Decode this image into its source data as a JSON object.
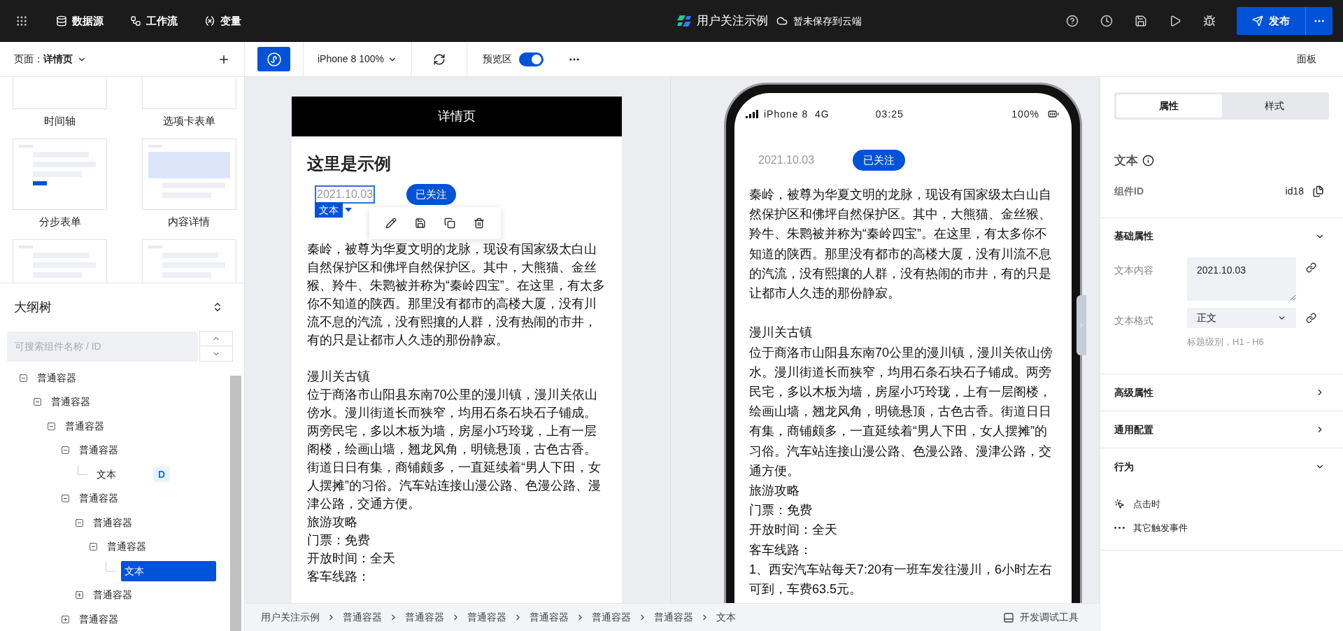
{
  "top_bar": {
    "menu": [
      {
        "label": "数据源"
      },
      {
        "label": "工作流"
      },
      {
        "label": "变量"
      }
    ],
    "app_title": "用户关注示例",
    "save_status": "暂未保存到云端",
    "publish_button": "发布"
  },
  "toolbar": {
    "page_label": "页面：**详情页**",
    "device": "iPhone 8 100%",
    "preview_label": "预览区",
    "preview_on": true,
    "panel_label": "面板"
  },
  "templates": [
    {
      "label": "时间轴"
    },
    {
      "label": "选项卡表单"
    },
    {
      "label": "分步表单"
    },
    {
      "label": "内容详情"
    }
  ],
  "outline": {
    "title": "大纲树",
    "search_placeholder": "可搜索组件名称 / ID",
    "tree": [
      {
        "label": "普通容器",
        "expanded": true,
        "selected": false,
        "children": [
          {
            "label": "普通容器",
            "expanded": true,
            "selected": false,
            "children": [
              {
                "label": "普通容器",
                "expanded": true,
                "selected": false,
                "children": [
                  {
                    "label": "普通容器",
                    "expanded": true,
                    "selected": false,
                    "children": [
                      {
                        "label": "文本",
                        "badge": "D",
                        "selected": false
                      }
                    ]
                  },
                  {
                    "label": "普通容器",
                    "expanded": true,
                    "selected": false,
                    "children": [
                      {
                        "label": "普通容器",
                        "expanded": true,
                        "selected": false,
                        "children": [
                          {
                            "label": "普通容器",
                            "expanded": true,
                            "selected": false,
                            "children": [
                              {
                                "label": "文本",
                                "selected": true
                              }
                            ]
                          }
                        ]
                      },
                      {
                        "label": "普通容器",
                        "expanded": false,
                        "selected": false
                      }
                    ]
                  },
                  {
                    "label": "普通容器",
                    "expanded": false,
                    "selected": false
                  }
                ]
              }
            ]
          }
        ]
      }
    ]
  },
  "canvas": {
    "page_title": "详情页",
    "heading": "这里是示例",
    "date": "2021.10.03",
    "selection_tag": "文本",
    "follow_button": "已关注",
    "paragraphs": [
      {
        "text": "秦岭，被尊为华夏文明的龙脉，现设有国家级太白山自然保护区和佛坪自然保护区。其中，大熊猫、金丝猴、羚牛、朱鹮被并称为“秦岭四宝”。在这里，有太多你不知道的陕西。那里没有都市的高楼大厦，没有川流不息的汽流，没有熙攘的人群，没有热闹的市井，有的只是让都市人久违的那份静寂。",
        "spaced": false
      },
      {
        "text": "漫川关古镇",
        "spaced": true
      },
      {
        "text": "位于商洛市山阳县东南70公里的漫川镇，漫川关依山傍水。漫川街道长而狭窄，均用石条石块石子铺成。两旁民宅，多以木板为墙，房屋小巧玲珑，上有一层阁楼，绘画山墙，翘龙风角，明镜悬顶，古色古香。街道日日有集，商铺颇多，一直延续着“男人下田，女人摆摊”的习俗。汽车站连接山漫公路、色漫公路、漫津公路，交通方便。",
        "spaced": false
      },
      {
        "text": "旅游攻略",
        "spaced": false
      },
      {
        "text": "门票：免费",
        "spaced": false
      },
      {
        "text": "开放时间：全天",
        "spaced": false
      },
      {
        "text": "客车线路：",
        "spaced": false
      }
    ]
  },
  "phone": {
    "carrier": "iPhone 8  4G",
    "time": "03:25",
    "battery": "100%",
    "date": "2021.10.03",
    "follow_button": "已关注",
    "paragraphs": [
      {
        "text": "秦岭，被尊为华夏文明的龙脉，现设有国家级太白山自然保护区和佛坪自然保护区。其中，大熊猫、金丝猴、羚牛、朱鹮被并称为“秦岭四宝”。在这里，有太多你不知道的陕西。那里没有都市的高楼大厦，没有川流不息的汽流，没有熙攘的人群，没有热闹的市井，有的只是让都市人久违的那份静寂。",
        "spaced": false
      },
      {
        "text": "漫川关古镇",
        "spaced": true
      },
      {
        "text": "位于商洛市山阳县东南70公里的漫川镇，漫川关依山傍水。漫川街道长而狭窄，均用石条石块石子铺成。两旁民宅，多以木板为墙，房屋小巧玲珑，上有一层阁楼，绘画山墙，翘龙风角，明镜悬顶，古色古香。街道日日有集，商铺颇多，一直延续着“男人下田，女人摆摊”的习俗。汽车站连接山漫公路、色漫公路、漫津公路，交通方便。",
        "spaced": false
      },
      {
        "text": "旅游攻略",
        "spaced": false
      },
      {
        "text": "门票：免费",
        "spaced": false
      },
      {
        "text": "开放时间：全天",
        "spaced": false
      },
      {
        "text": "客车线路：",
        "spaced": false
      },
      {
        "text": "1、西安汽车站每天7:20有一班车发往漫川，6小时左右可到，车费63.5元。",
        "spaced": false
      }
    ]
  },
  "breadcrumb": {
    "items": [
      "用户关注示例",
      "普通容器",
      "普通容器",
      "普通容器",
      "普通容器",
      "普通容器",
      "普通容器",
      "文本"
    ],
    "dev_tools": "开发调试工具"
  },
  "right_panel": {
    "tabs": [
      {
        "label": "属性",
        "selected": true
      },
      {
        "label": "样式",
        "selected": false
      }
    ],
    "component_type": "文本",
    "id_label": "组件ID",
    "id_value": "id18",
    "sections": [
      {
        "title": "基础属性",
        "expanded": true,
        "fields": [
          {
            "label": "文本内容",
            "kind": "textarea",
            "value": "2021.10.03"
          },
          {
            "label": "文本格式",
            "kind": "select",
            "value": "正文",
            "hint": "标题级别，H1 - H6"
          }
        ]
      },
      {
        "title": "高级属性",
        "expanded": false
      },
      {
        "title": "通用配置",
        "expanded": false
      },
      {
        "title": "行为",
        "expanded": true,
        "events": [
          "点击时",
          "其它触发事件"
        ]
      }
    ]
  }
}
